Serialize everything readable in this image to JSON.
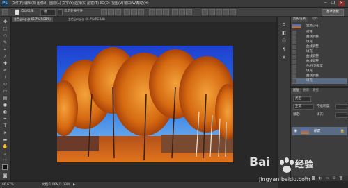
{
  "app": {
    "logo": "Ps"
  },
  "menu": [
    "文件(F)",
    "编辑(E)",
    "图像(I)",
    "图层(L)",
    "文字(Y)",
    "选择(S)",
    "滤镜(T)",
    "3D(D)",
    "视图(V)",
    "窗口(W)",
    "帮助(H)"
  ],
  "window_controls": {
    "minimize": "─",
    "restore": "❐",
    "close": "✕"
  },
  "options": {
    "auto_select_label": "自动选择:",
    "auto_select_value": "组",
    "show_transform": "显示变换控件",
    "workspace": "基本功能"
  },
  "tabs": [
    {
      "label": "金色.jpeg @ 66.7%(RGB/8)",
      "active": true
    },
    {
      "label": "金色.jpeg @ 66.7%(RGB/8)",
      "active": false
    }
  ],
  "status": {
    "zoom": "66.67%",
    "doc": "文档:1.06M/2.08M",
    "arrow": "▶"
  },
  "history_panel": {
    "tabs": [
      "历史记录",
      "动作"
    ],
    "source": "金色.jpg",
    "items": [
      "打开",
      "曲线调整",
      "填充",
      "曲线调整",
      "填充",
      "曲线调整",
      "曲线调整",
      "色相/饱和度",
      "填充",
      "曲线调整",
      "填充"
    ],
    "selected_index": 10
  },
  "layers_panel": {
    "tabs": [
      "图层",
      "通道",
      "路径"
    ],
    "kind_label": "类型",
    "blend_mode": "正常",
    "opacity_label": "不透明度:",
    "lock_label": "锁定:",
    "fill_label": "填充:",
    "layer_name": "背景",
    "lock_icon": "🔒"
  },
  "watermark": {
    "brand": "Bai",
    "brand2": "经验",
    "url": "jingyan.baidu.com"
  },
  "colors": {
    "accent_selected": "#5a6b86",
    "ps_blue": "#5fb4ff",
    "sky": "#1f5fd8",
    "foliage": "#d87418"
  }
}
